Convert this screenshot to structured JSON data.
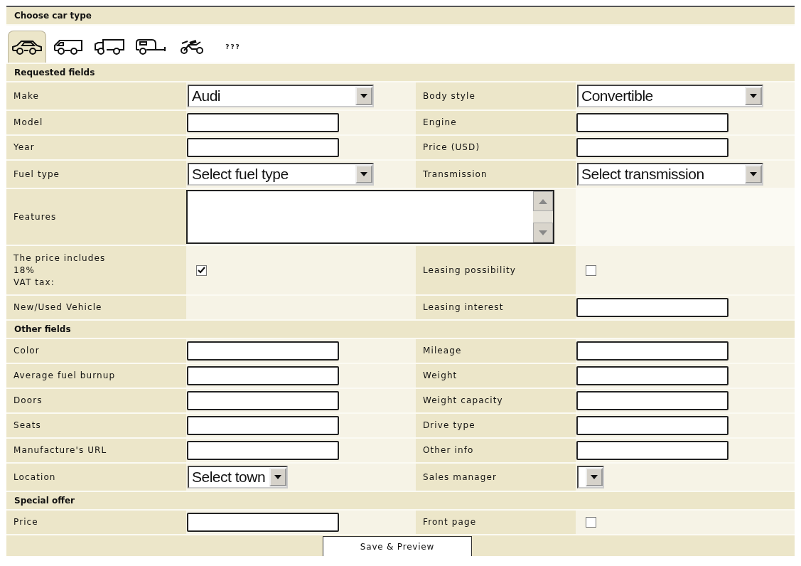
{
  "car_type": {
    "title": "Choose car type",
    "types": [
      {
        "kind": "car",
        "selected": true
      },
      {
        "kind": "van",
        "selected": false
      },
      {
        "kind": "truck",
        "selected": false
      },
      {
        "kind": "camper",
        "selected": false
      },
      {
        "kind": "motorbike",
        "selected": false
      },
      {
        "kind": "other",
        "label": "???",
        "selected": false
      }
    ]
  },
  "sections": [
    {
      "title": "Requested fields",
      "rows": [
        {
          "fields": [
            {
              "label": "Make",
              "kind": "select",
              "value": "Audi"
            },
            {
              "label": "Body style",
              "kind": "select",
              "value": "Convertible"
            }
          ]
        },
        {
          "fields": [
            {
              "label": "Model",
              "kind": "text"
            },
            {
              "label": "Engine",
              "kind": "text"
            }
          ]
        },
        {
          "fields": [
            {
              "label": "Year",
              "kind": "text"
            },
            {
              "label": "Price (USD)",
              "kind": "text"
            }
          ]
        },
        {
          "fields": [
            {
              "label": "Fuel type",
              "kind": "select",
              "value": "Select fuel type"
            },
            {
              "label": "Transmission",
              "kind": "select",
              "value": "Select transmission"
            }
          ]
        },
        {
          "fields": [
            {
              "label": "Features",
              "kind": "textarea"
            }
          ]
        },
        {
          "fields": [
            {
              "label": "The price includes\n18%\nVAT tax:",
              "kind": "checkbox",
              "checked": true
            },
            {
              "label": "Leasing possibility",
              "kind": "checkbox",
              "checked": false
            }
          ]
        },
        {
          "fields": [
            {
              "label": "New/Used Vehicle",
              "kind": "none"
            },
            {
              "label": "Leasing interest",
              "kind": "text"
            }
          ]
        }
      ]
    },
    {
      "title": "Other fields",
      "rows": [
        {
          "fields": [
            {
              "label": "Color",
              "kind": "text"
            },
            {
              "label": "Mileage",
              "kind": "text"
            }
          ]
        },
        {
          "fields": [
            {
              "label": "Average fuel burnup",
              "kind": "text"
            },
            {
              "label": "Weight",
              "kind": "text"
            }
          ]
        },
        {
          "fields": [
            {
              "label": "Doors",
              "kind": "text"
            },
            {
              "label": "Weight capacity",
              "kind": "text"
            }
          ]
        },
        {
          "fields": [
            {
              "label": "Seats",
              "kind": "text"
            },
            {
              "label": "Drive type",
              "kind": "text"
            }
          ]
        },
        {
          "fields": [
            {
              "label": "Manufacture's URL",
              "kind": "text"
            },
            {
              "label": "Other info",
              "kind": "text"
            }
          ]
        },
        {
          "fields": [
            {
              "label": "Location",
              "kind": "select",
              "value": "Select town"
            },
            {
              "label": "Sales manager",
              "kind": "select"
            }
          ]
        }
      ]
    },
    {
      "title": "Special offer",
      "rows": [
        {
          "fields": [
            {
              "label": "Price",
              "kind": "text"
            },
            {
              "label": "Front page",
              "kind": "checkbox",
              "checked": false
            }
          ]
        }
      ]
    }
  ],
  "save_button": "Save & Preview"
}
